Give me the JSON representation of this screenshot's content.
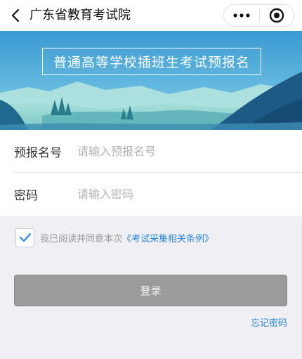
{
  "navbar": {
    "title": "广东省教育考试院",
    "back_icon": "back-arrow-icon",
    "more_icon": "more-dots-icon",
    "close_icon": "target-close-icon"
  },
  "banner": {
    "title": "普通高等学校插班生考试预报名"
  },
  "form": {
    "reg_no_label": "预报名号",
    "reg_no_placeholder": "请输入预报名号",
    "reg_no_value": "",
    "password_label": "密码",
    "password_placeholder": "请输入密码",
    "password_value": ""
  },
  "agreement": {
    "checked": true,
    "text": "我已阅读并同意本次",
    "link": "《考试采集相关条例》"
  },
  "actions": {
    "login_label": "登录",
    "forgot_label": "忘记密码"
  },
  "colors": {
    "link": "#2d86d8",
    "button_disabled": "#9b9b9b",
    "banner_sky_top": "#3fa2d6",
    "banner_mountain": "#1f5f8f"
  }
}
